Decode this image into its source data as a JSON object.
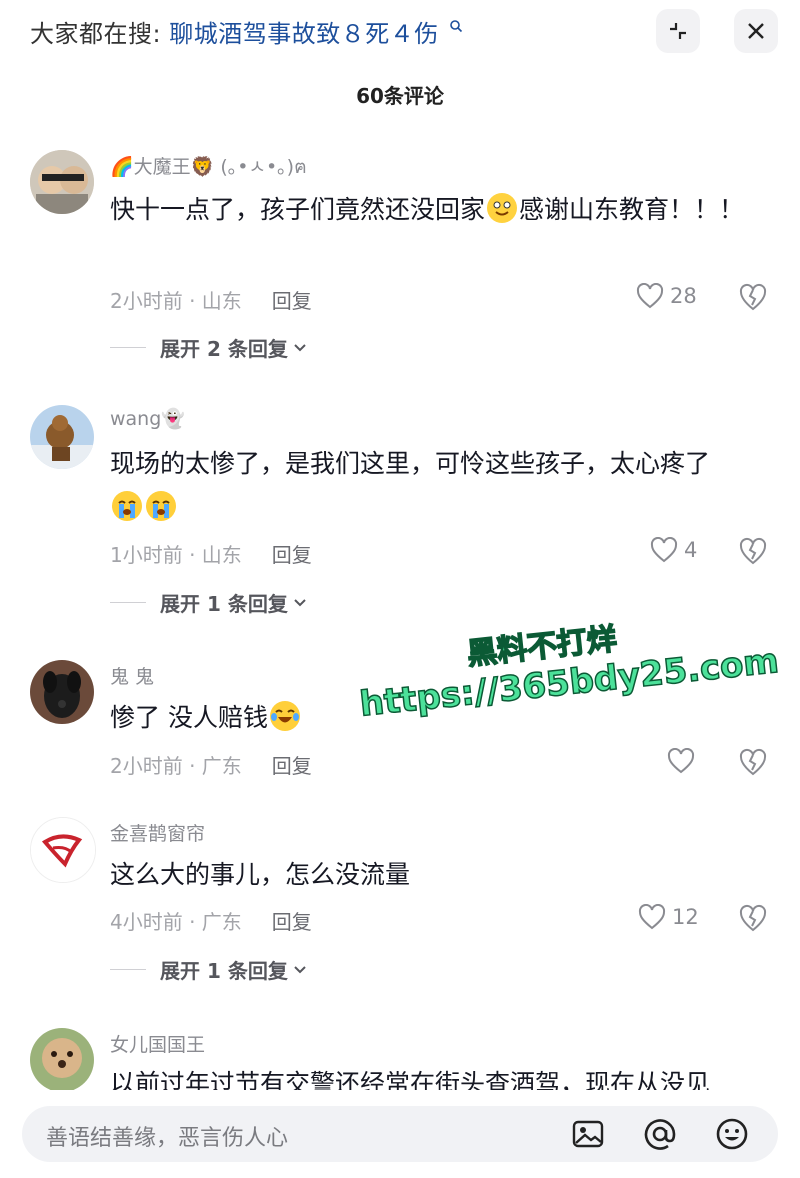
{
  "header": {
    "search_prefix": "大家都在搜:",
    "search_topic": "聊城酒驾事故致８死４伤",
    "comment_count_title": "60条评论"
  },
  "comments": [
    {
      "username": "🌈大魔王🦁 (｡•ㅅ•｡)ฅ",
      "text_part1": "快十一点了，孩子们竟然还没回家",
      "text_part2": "感谢山东教育！！！",
      "time_location": "2小时前 · 山东",
      "reply_label": "回复",
      "likes": "28",
      "expand_label": "展开 2 条回复"
    },
    {
      "username": "wang👻",
      "text": "现场的太惨了，是我们这里，可怜这些孩子，太心疼了",
      "time_location": "1小时前 · 山东",
      "reply_label": "回复",
      "likes": "4",
      "expand_label": "展开 1 条回复"
    },
    {
      "username": "鬼 鬼",
      "text": "惨了 没人赔钱",
      "time_location": "2小时前 · 广东",
      "reply_label": "回复",
      "likes": ""
    },
    {
      "username": "金喜鹊窗帘",
      "text": "这么大的事儿，怎么没流量",
      "time_location": "4小时前 · 广东",
      "reply_label": "回复",
      "likes": "12",
      "expand_label": "展开 1 条回复"
    },
    {
      "username": "女儿国国王",
      "text": "以前过年过节有交警还经常在街头查酒驾，现在从没见"
    }
  ],
  "watermark": {
    "line1": "黑料不打烊",
    "line2": "https://365bdy25.com"
  },
  "input": {
    "placeholder": "善语结善缘，恶言伤人心"
  },
  "icons": {
    "search": "search-icon",
    "collapse": "collapse-icon",
    "close": "close-icon",
    "like": "heart-icon",
    "dislike": "broken-heart-icon",
    "image": "image-icon",
    "mention": "at-icon",
    "emoji": "emoji-icon"
  }
}
